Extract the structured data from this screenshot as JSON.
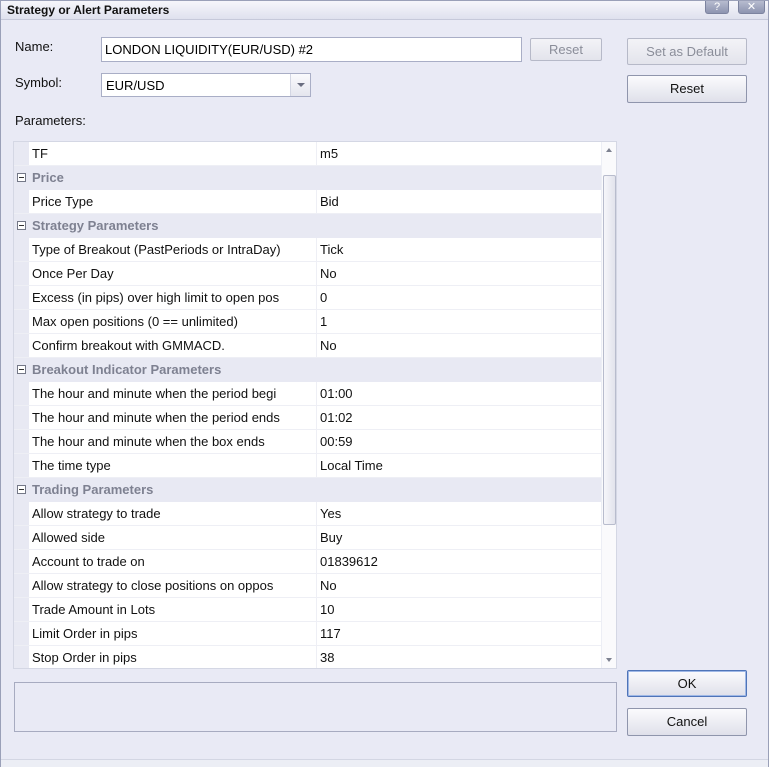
{
  "window": {
    "title": "Strategy or Alert Parameters",
    "help_glyph": "?",
    "close_glyph": "✕"
  },
  "name_label": "Name:",
  "name_value": "LONDON LIQUIDITY(EUR/USD) #2",
  "name_reset_label": "Reset",
  "set_default_label": "Set as Default",
  "reset_label": "Reset",
  "symbol_label": "Symbol:",
  "symbol_value": "EUR/USD",
  "parameters_label": "Parameters:",
  "grid": {
    "rows": [
      {
        "type": "prop",
        "name": "TF",
        "value": "m5"
      },
      {
        "type": "cat",
        "name": "Price"
      },
      {
        "type": "prop",
        "name": "Price Type",
        "value": "Bid"
      },
      {
        "type": "cat",
        "name": "Strategy Parameters"
      },
      {
        "type": "prop",
        "name": "Type of Breakout (PastPeriods or IntraDay)",
        "value": "Tick"
      },
      {
        "type": "prop",
        "name": "Once Per Day",
        "value": "No"
      },
      {
        "type": "prop",
        "name": "Excess (in pips) over high limit to open pos",
        "value": "0"
      },
      {
        "type": "prop",
        "name": "Max open positions (0 == unlimited)",
        "value": "1"
      },
      {
        "type": "prop",
        "name": "Confirm breakout with GMMACD.",
        "value": "No"
      },
      {
        "type": "cat",
        "name": "Breakout Indicator Parameters"
      },
      {
        "type": "prop",
        "name": "The hour and minute when the period begi",
        "value": "01:00"
      },
      {
        "type": "prop",
        "name": "The hour and minute when the period ends",
        "value": "01:02"
      },
      {
        "type": "prop",
        "name": "The hour and minute when the box ends",
        "value": "00:59"
      },
      {
        "type": "prop",
        "name": "The time type",
        "value": "Local Time"
      },
      {
        "type": "cat",
        "name": "Trading Parameters"
      },
      {
        "type": "prop",
        "name": "Allow strategy to trade",
        "value": "Yes"
      },
      {
        "type": "prop",
        "name": "Allowed side",
        "value": "Buy"
      },
      {
        "type": "prop",
        "name": "Account to trade on",
        "value": "01839612"
      },
      {
        "type": "prop",
        "name": "Allow strategy to close positions on oppos",
        "value": "No"
      },
      {
        "type": "prop",
        "name": "Trade Amount in Lots",
        "value": "10"
      },
      {
        "type": "prop",
        "name": "Limit Order in pips",
        "value": "117"
      },
      {
        "type": "prop",
        "name": "Stop Order in pips",
        "value": "38"
      }
    ]
  },
  "description_text": "",
  "ok_label": "OK",
  "cancel_label": "Cancel"
}
